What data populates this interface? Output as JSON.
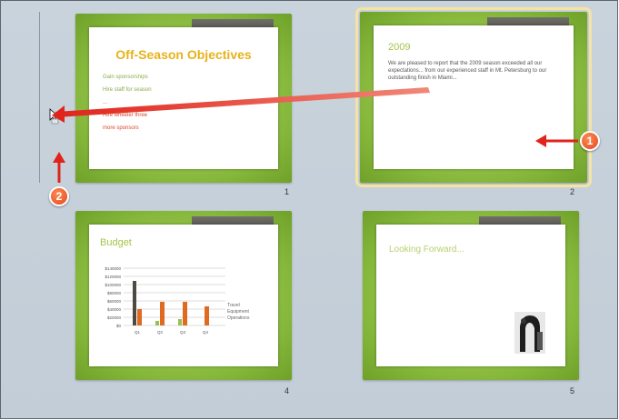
{
  "slides": [
    {
      "number": "1",
      "title": "Off-Season Objectives",
      "bullets": [
        "Gain sponsorships",
        "Hire staff for season",
        "...",
        "Hire wheeler three",
        "more sponsors"
      ]
    },
    {
      "number": "2",
      "heading": "2009",
      "body": "We are pleased to report that the 2009 season exceeded all our expectations... from our experienced staff in Mt. Petersburg to our outstanding finish in Miami..."
    },
    {
      "number": "4",
      "title": "Budget",
      "chart": {
        "y_ticks": [
          "$140000",
          "$120000",
          "$100000",
          "$80000",
          "$60000",
          "$40000",
          "$20000",
          "$0"
        ],
        "categories": [
          "Q1",
          "Q2",
          "Q3",
          "Q4"
        ],
        "legend": [
          "Travel",
          "Equipment",
          "Operations"
        ]
      }
    },
    {
      "number": "5",
      "title": "Looking Forward..."
    }
  ],
  "callouts": [
    "1",
    "2"
  ],
  "colors": {
    "accent_green": "#86b83c",
    "callout_orange": "#e2451e",
    "arrow_red": "#e0241b"
  }
}
